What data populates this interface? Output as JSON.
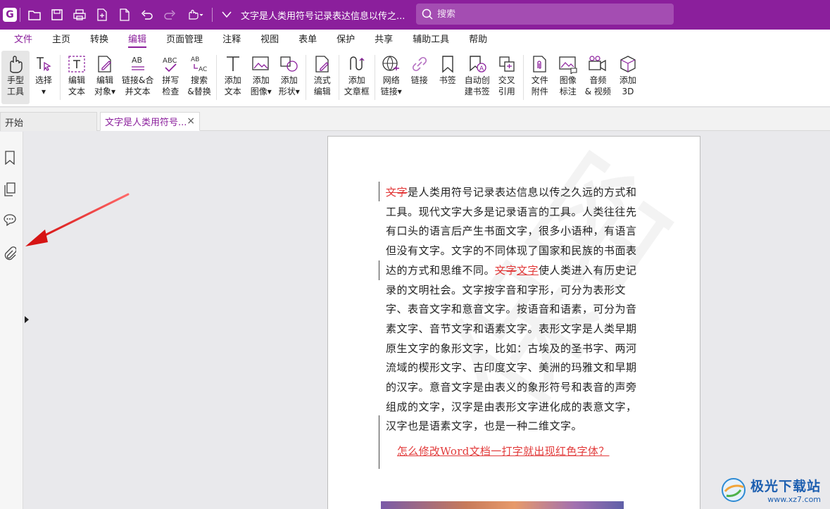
{
  "titlebar": {
    "document_title": "文字是人类用符号记录表达信息以传之...",
    "search_placeholder": "搜索",
    "accent_color": "#8b1f9c"
  },
  "menu": {
    "items": [
      "文件",
      "主页",
      "转换",
      "编辑",
      "页面管理",
      "注释",
      "视图",
      "表单",
      "保护",
      "共享",
      "辅助工具",
      "帮助"
    ],
    "active": "编辑"
  },
  "ribbon": {
    "buttons": [
      {
        "label": "手型\n工具",
        "icon": "hand-icon"
      },
      {
        "label": "选择\n▾",
        "icon": "select-cursor-icon"
      },
      {
        "label": "编辑\n文本",
        "icon": "edit-text-icon"
      },
      {
        "label": "编辑\n对象▾",
        "icon": "edit-object-icon"
      },
      {
        "label": "链接&合\n并文本",
        "icon": "link-merge-text-icon"
      },
      {
        "label": "拼写\n检查",
        "icon": "spell-check-icon"
      },
      {
        "label": "搜索\n&替换",
        "icon": "search-replace-icon"
      },
      {
        "label": "添加\n文本",
        "icon": "add-text-icon"
      },
      {
        "label": "添加\n图像▾",
        "icon": "add-image-icon"
      },
      {
        "label": "添加\n形状▾",
        "icon": "add-shape-icon"
      },
      {
        "label": "流式\n编辑",
        "icon": "flow-edit-icon"
      },
      {
        "label": "添加\n文章框",
        "icon": "article-box-icon"
      },
      {
        "label": "网络\n链接▾",
        "icon": "web-link-icon"
      },
      {
        "label": "链接",
        "icon": "link-icon"
      },
      {
        "label": "书签",
        "icon": "bookmark-icon"
      },
      {
        "label": "自动创\n建书签",
        "icon": "auto-bookmark-icon"
      },
      {
        "label": "交叉\n引用",
        "icon": "cross-reference-icon"
      },
      {
        "label": "文件\n附件",
        "icon": "file-attachment-icon"
      },
      {
        "label": "图像\n标注",
        "icon": "image-annotation-icon"
      },
      {
        "label": "音频\n& 视频",
        "icon": "audio-video-icon"
      },
      {
        "label": "添加\n3D",
        "icon": "add-3d-icon"
      }
    ]
  },
  "tabs": {
    "home": "开始",
    "document": "文字是人类用符号...",
    "close": "×"
  },
  "document": {
    "paragraph_struck_lead": "文字",
    "paragraph_part1": "是人类用符号记录表达信息以传之久远的方式和工具。现代文字大多是记录语言的工具。人类往往先有口头的语言后产生书面文字，很多小语种，有语言但没有文字。文字的不同体现了国家和民族的书面表达的方式和思维不同。",
    "paragraph_struck_mid": "文字",
    "paragraph_underlined_mid": "文字",
    "paragraph_part2": "使人类进入有历史记录的文明社会。文字按字音和字形，可分为表形文字、表音文字和意音文字。按语音和语素，可分为音素文字、音节文字和语素文字。表形文字是人类早期原生文字的象形文字，比如：古埃及的圣书字、两河流域的楔形文字、古印度文字、美洲的玛雅文和早期的汉字。意音文字是由表义的象形符号和表音的声旁组成的文字，汉字是由表形文字进化成的表意文字，汉字也是语素文字，也是一种二维文字。",
    "link_text": "怎么修改Word文档一打字就出现红色字体？",
    "watermark": "保密"
  },
  "site_logo": {
    "name": "极光下载站",
    "url": "www.xz7.com"
  }
}
